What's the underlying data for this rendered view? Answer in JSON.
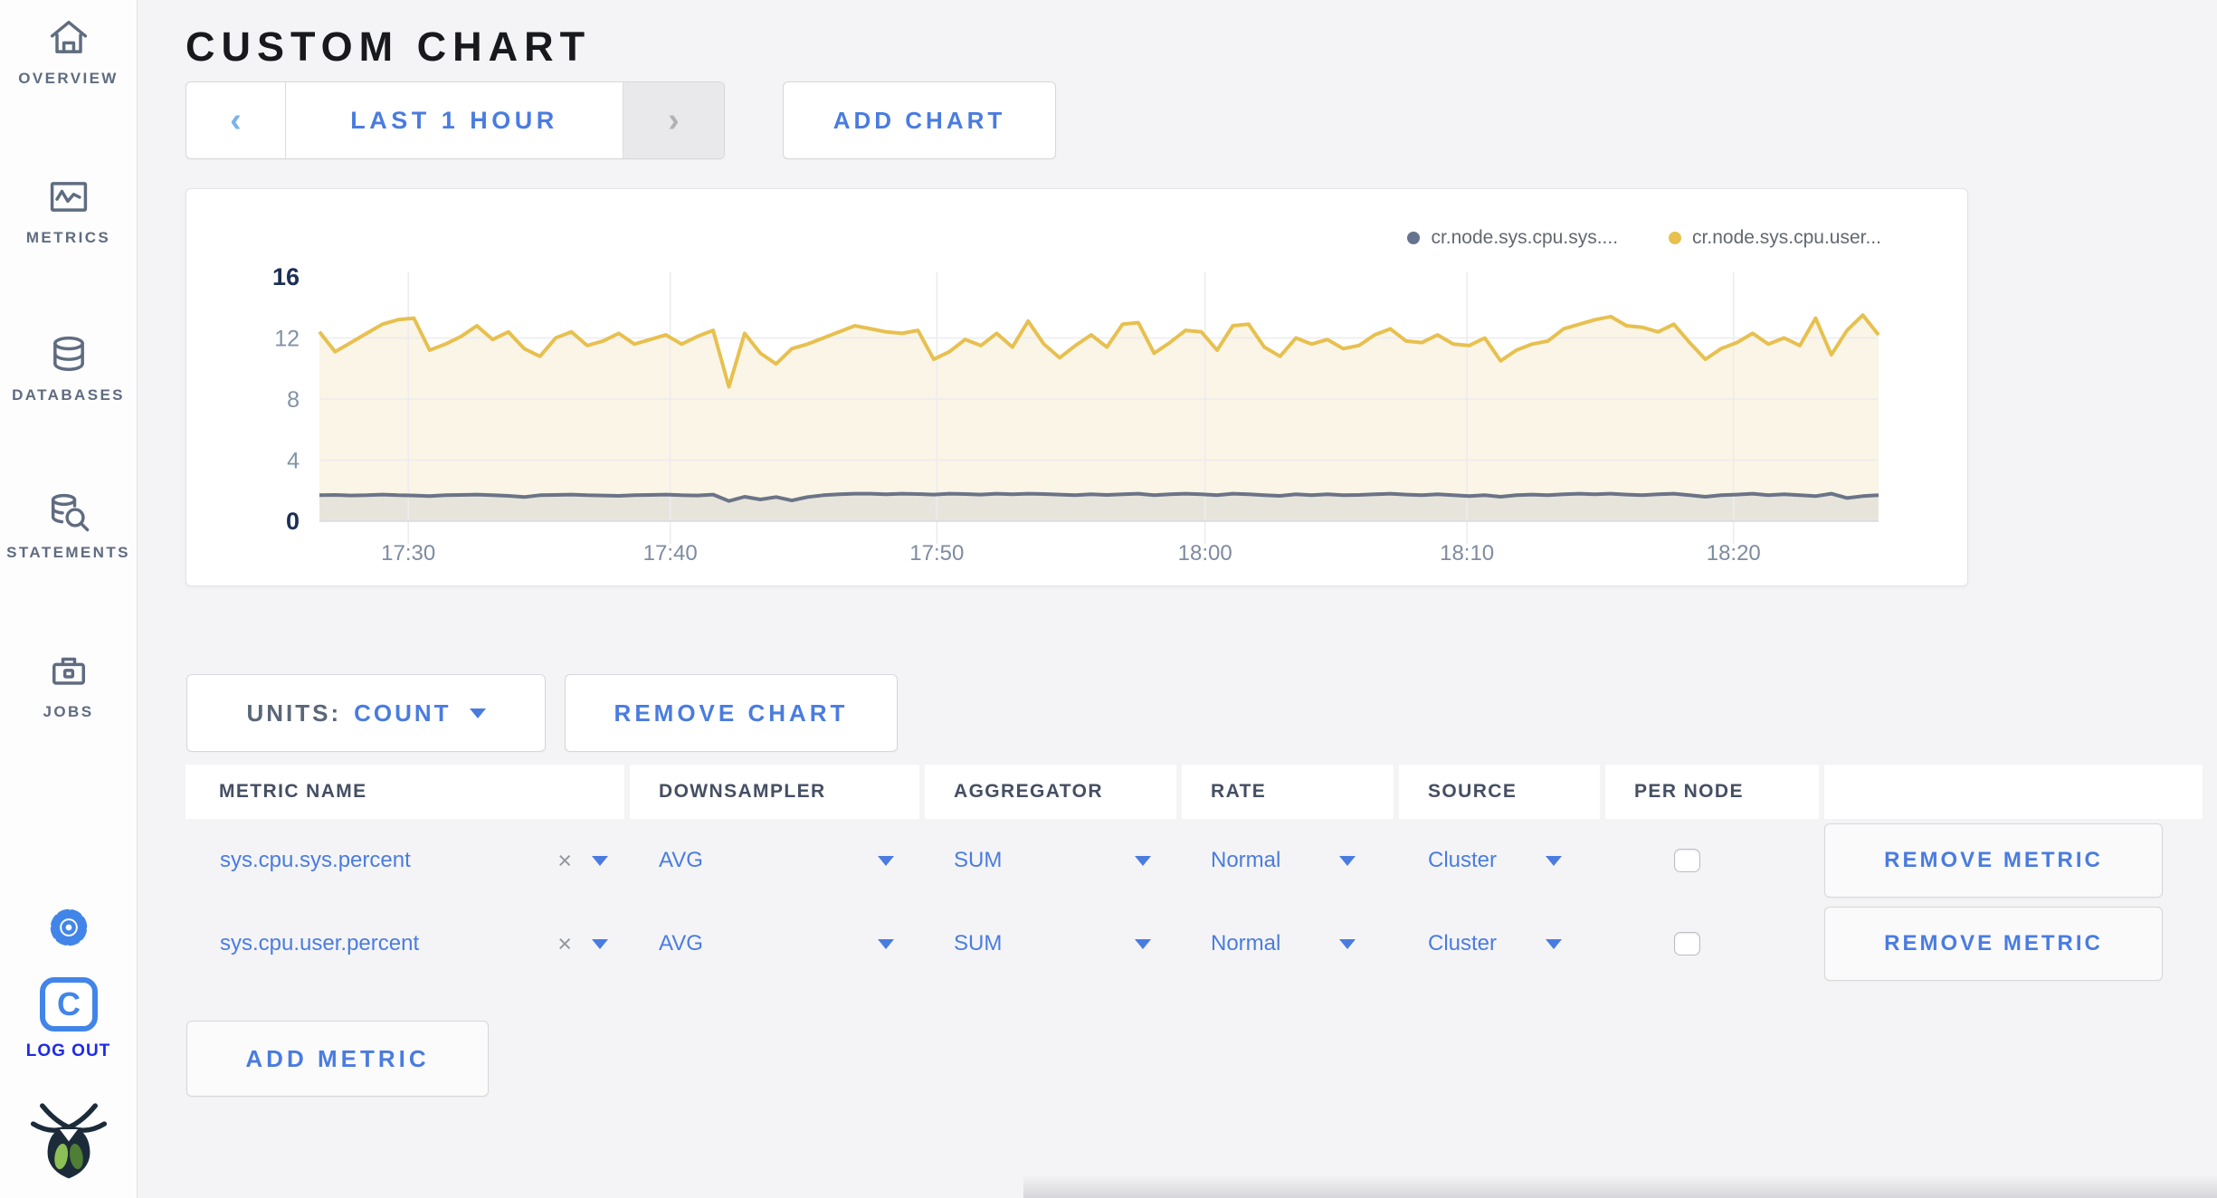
{
  "sidebar": {
    "items": [
      {
        "label": "OVERVIEW"
      },
      {
        "label": "METRICS"
      },
      {
        "label": "DATABASES"
      },
      {
        "label": "STATEMENTS"
      },
      {
        "label": "JOBS"
      }
    ],
    "log_out_label": "LOG OUT"
  },
  "header": {
    "title": "CUSTOM CHART"
  },
  "toolbar": {
    "prev_label": "‹",
    "time_range_label": "LAST 1 HOUR",
    "next_label": "›",
    "add_chart_label": "ADD CHART"
  },
  "chart_data": {
    "type": "line",
    "title": "",
    "ylim": [
      0,
      16
    ],
    "y_ticks": [
      0,
      4,
      8,
      12,
      16
    ],
    "x_ticks": [
      "17:30",
      "17:40",
      "17:50",
      "18:00",
      "18:10",
      "18:20"
    ],
    "x_tick_fractions": [
      0.057,
      0.225,
      0.396,
      0.568,
      0.736,
      0.907
    ],
    "grid": true,
    "legend_position": "top-right",
    "legend": [
      {
        "name": "cr.node.sys.cpu.sys....",
        "color": "#66738f"
      },
      {
        "name": "cr.node.sys.cpu.user...",
        "color": "#e7c04f"
      }
    ],
    "series": [
      {
        "name": "cr.node.sys.cpu.sys....",
        "color": "#6b7487",
        "fill": "rgba(110,122,147,0.13)",
        "values": [
          1.7,
          1.72,
          1.68,
          1.7,
          1.74,
          1.7,
          1.68,
          1.65,
          1.7,
          1.72,
          1.74,
          1.7,
          1.66,
          1.58,
          1.7,
          1.72,
          1.74,
          1.7,
          1.68,
          1.66,
          1.7,
          1.72,
          1.74,
          1.7,
          1.68,
          1.74,
          1.32,
          1.6,
          1.42,
          1.58,
          1.36,
          1.58,
          1.7,
          1.76,
          1.8,
          1.8,
          1.76,
          1.8,
          1.78,
          1.74,
          1.8,
          1.78,
          1.74,
          1.8,
          1.76,
          1.8,
          1.78,
          1.74,
          1.7,
          1.76,
          1.72,
          1.76,
          1.8,
          1.7,
          1.76,
          1.8,
          1.76,
          1.7,
          1.8,
          1.76,
          1.7,
          1.66,
          1.76,
          1.7,
          1.76,
          1.7,
          1.72,
          1.76,
          1.8,
          1.74,
          1.7,
          1.76,
          1.7,
          1.64,
          1.7,
          1.6,
          1.7,
          1.74,
          1.7,
          1.76,
          1.8,
          1.76,
          1.8,
          1.74,
          1.7,
          1.76,
          1.8,
          1.7,
          1.6,
          1.7,
          1.74,
          1.8,
          1.7,
          1.76,
          1.7,
          1.64,
          1.8,
          1.52,
          1.64,
          1.7
        ]
      },
      {
        "name": "cr.node.sys.cpu.user...",
        "color": "#e7c04f",
        "fill": "#faf5e6",
        "values": [
          12.4,
          11.1,
          11.7,
          12.3,
          12.9,
          13.2,
          13.3,
          11.2,
          11.6,
          12.1,
          12.8,
          11.9,
          12.4,
          11.3,
          10.8,
          12.0,
          12.4,
          11.5,
          11.8,
          12.3,
          11.6,
          11.9,
          12.2,
          11.6,
          12.1,
          12.5,
          8.8,
          12.3,
          11.0,
          10.3,
          11.3,
          11.6,
          12.0,
          12.4,
          12.8,
          12.6,
          12.4,
          12.3,
          12.5,
          10.6,
          11.1,
          11.9,
          11.5,
          12.3,
          11.4,
          13.1,
          11.6,
          10.7,
          11.5,
          12.2,
          11.4,
          12.9,
          13.0,
          11.0,
          11.7,
          12.5,
          12.4,
          11.2,
          12.8,
          12.9,
          11.4,
          10.8,
          12.0,
          11.6,
          11.9,
          11.3,
          11.5,
          12.2,
          12.6,
          11.8,
          11.7,
          12.2,
          11.6,
          11.5,
          12.0,
          10.5,
          11.2,
          11.6,
          11.8,
          12.6,
          12.9,
          13.2,
          13.4,
          12.8,
          12.7,
          12.4,
          12.9,
          11.7,
          10.6,
          11.3,
          11.7,
          12.3,
          11.6,
          12.0,
          11.5,
          13.3,
          10.9,
          12.5,
          13.5,
          12.2
        ]
      }
    ]
  },
  "chart_controls": {
    "units_label": "UNITS:",
    "units_value": "COUNT",
    "remove_chart_label": "REMOVE CHART"
  },
  "metrics_table": {
    "columns": [
      "METRIC NAME",
      "DOWNSAMPLER",
      "AGGREGATOR",
      "RATE",
      "SOURCE",
      "PER NODE",
      ""
    ],
    "clear_glyph": "×",
    "rows": [
      {
        "name": "sys.cpu.sys.percent",
        "downsampler": "AVG",
        "aggregator": "SUM",
        "rate": "Normal",
        "source": "Cluster",
        "per_node": false,
        "remove_label": "REMOVE METRIC"
      },
      {
        "name": "sys.cpu.user.percent",
        "downsampler": "AVG",
        "aggregator": "SUM",
        "rate": "Normal",
        "source": "Cluster",
        "per_node": false,
        "remove_label": "REMOVE METRIC"
      }
    ],
    "add_metric_label": "ADD METRIC"
  },
  "colors": {
    "accent_blue": "#4a7ce0",
    "logout_blue": "#1d2ae8",
    "sidebar_grey": "#5f6c80",
    "series_user_yellow": "#e7c04f",
    "series_sys_grey": "#6b7487"
  }
}
